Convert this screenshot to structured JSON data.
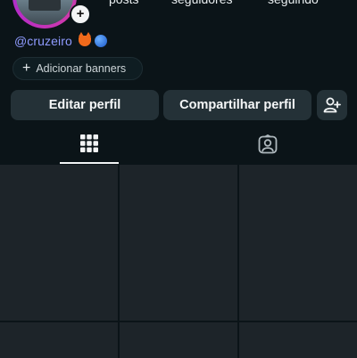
{
  "profile": {
    "handle": "@cruzeiro",
    "handle_emojis": [
      "fox-emoji",
      "blue-circle-emoji"
    ]
  },
  "stats": [
    {
      "label": "posts"
    },
    {
      "label": "seguidores"
    },
    {
      "label": "seguindo"
    }
  ],
  "buttons": {
    "add_banners": "Adicionar banners",
    "edit_profile": "Editar perfil",
    "share_profile": "Compartilhar perfil"
  },
  "tabs": [
    {
      "icon": "grid-icon",
      "active": true
    },
    {
      "icon": "tagged-person-icon",
      "active": false
    }
  ],
  "colors": {
    "background": "#0b1418",
    "button": "#243137",
    "handle": "#8f9bff",
    "tile": "#1d2429",
    "story_ring": "#b72cc7"
  },
  "grid": {
    "columns": 3,
    "visible_rows": 2,
    "tiles_visible": 6
  }
}
